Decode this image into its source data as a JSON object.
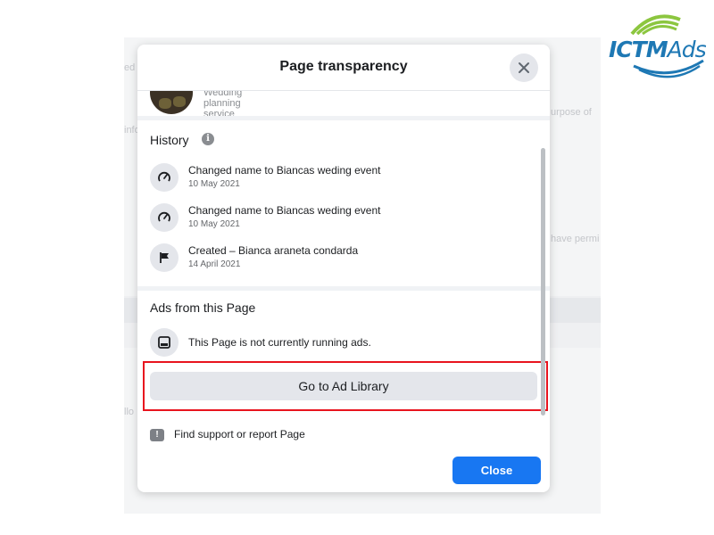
{
  "logo": {
    "brand_text_1": "ICTM",
    "brand_text_2": "Ads",
    "colors": {
      "primary": "#1e78b4",
      "accent": "#8cc63f"
    }
  },
  "background_page": {
    "fragments": [
      "ed",
      "info",
      "urpose of",
      "have permi",
      "llo"
    ]
  },
  "modal": {
    "title": "Page transparency",
    "close_icon": "close-icon",
    "page_category": "Wedding planning service",
    "history": {
      "title": "History",
      "info_icon": "i",
      "items": [
        {
          "icon": "name-change-icon",
          "text": "Changed name to Biancas weding event",
          "date": "10 May 2021"
        },
        {
          "icon": "name-change-icon",
          "text": "Changed name to Biancas weding event",
          "date": "10 May 2021"
        },
        {
          "icon": "flag-icon",
          "text": "Created – Bianca araneta condarda",
          "date": "14 April 2021"
        }
      ]
    },
    "ads": {
      "title": "Ads from this Page",
      "icon": "ad-library-icon",
      "status_text": "This Page is not currently running ads.",
      "button_label": "Go to Ad Library"
    },
    "report": {
      "icon": "!",
      "label": "Find support or report Page"
    },
    "close_button_label": "Close",
    "colors": {
      "primary_button": "#1877f2",
      "highlight": "#e8141e"
    }
  }
}
